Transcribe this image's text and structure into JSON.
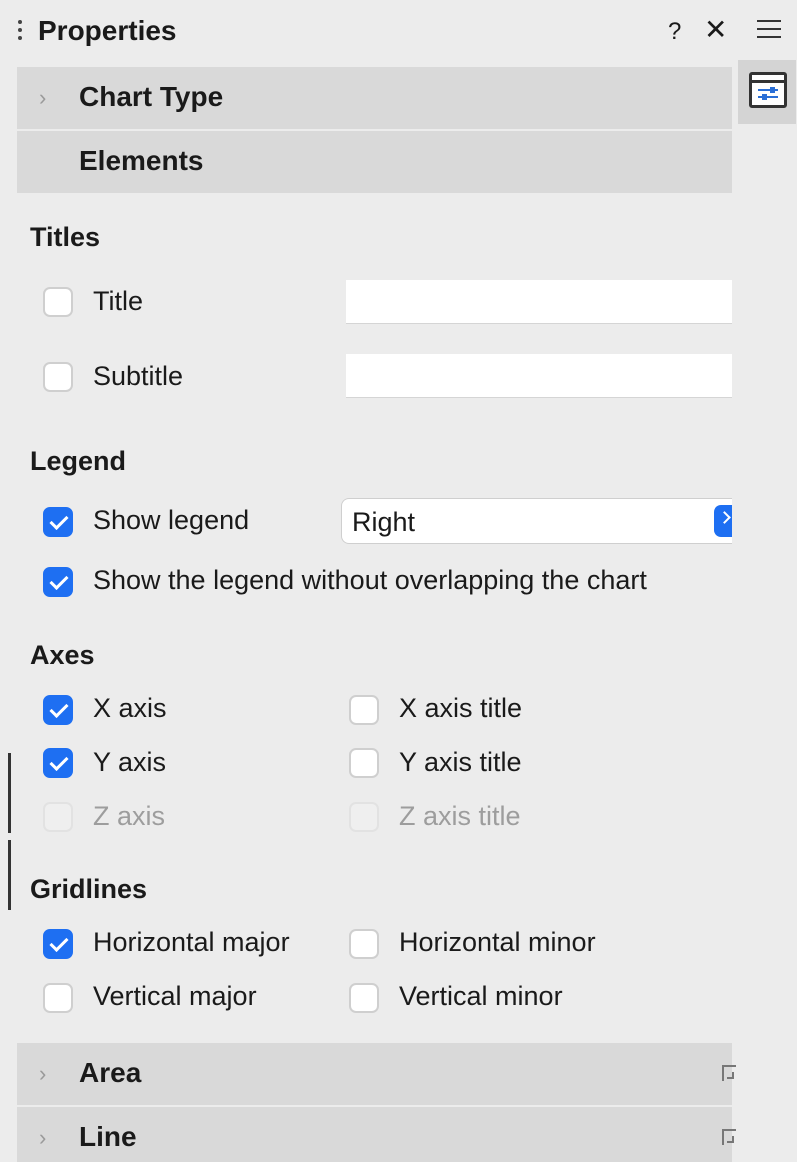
{
  "header": {
    "title": "Properties",
    "help_label": "?",
    "close_label": "✕"
  },
  "sections": {
    "chart_type": {
      "label": "Chart Type",
      "expanded": false
    },
    "elements": {
      "label": "Elements",
      "expanded": true
    },
    "area": {
      "label": "Area",
      "expanded": false
    },
    "line": {
      "label": "Line",
      "expanded": false
    }
  },
  "titles": {
    "group_label": "Titles",
    "title": {
      "label": "Title",
      "checked": false,
      "value": ""
    },
    "subtitle": {
      "label": "Subtitle",
      "checked": false,
      "value": ""
    }
  },
  "legend": {
    "group_label": "Legend",
    "show_legend": {
      "label": "Show legend",
      "checked": true
    },
    "position": "Right",
    "no_overlap": {
      "label": "Show the legend without overlapping the chart",
      "checked": true
    }
  },
  "axes": {
    "group_label": "Axes",
    "x_axis": {
      "label": "X axis",
      "checked": true
    },
    "y_axis": {
      "label": "Y axis",
      "checked": true
    },
    "z_axis": {
      "label": "Z axis",
      "checked": false,
      "disabled": true
    },
    "x_axis_title": {
      "label": "X axis title",
      "checked": false
    },
    "y_axis_title": {
      "label": "Y axis title",
      "checked": false
    },
    "z_axis_title": {
      "label": "Z axis title",
      "checked": false,
      "disabled": true
    }
  },
  "gridlines": {
    "group_label": "Gridlines",
    "horizontal_major": {
      "label": "Horizontal major",
      "checked": true
    },
    "horizontal_minor": {
      "label": "Horizontal minor",
      "checked": false
    },
    "vertical_major": {
      "label": "Vertical major",
      "checked": false
    },
    "vertical_minor": {
      "label": "Vertical minor",
      "checked": false
    }
  },
  "colors": {
    "accent": "#1e6ff2",
    "section_header_bg": "#d9d9d9",
    "panel_bg": "#ececec"
  }
}
